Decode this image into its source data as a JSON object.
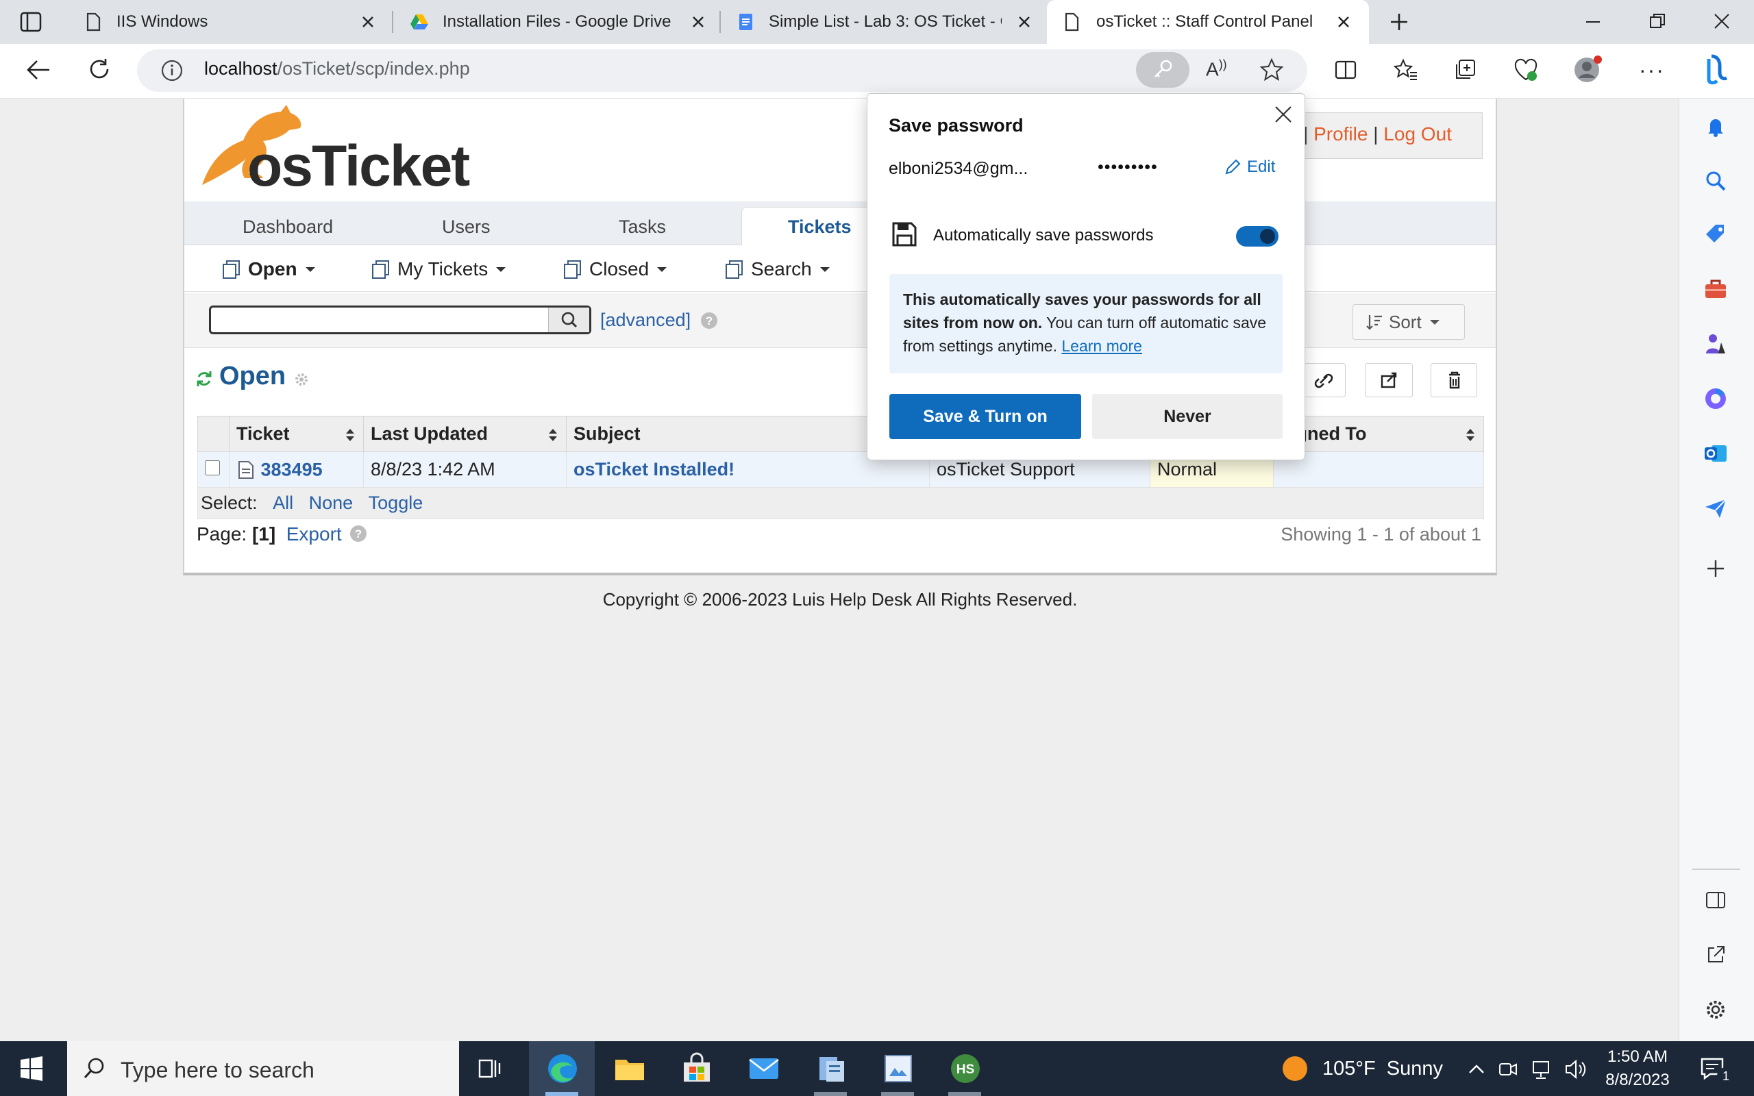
{
  "tabs": [
    {
      "title": "IIS Windows"
    },
    {
      "title": "Installation Files - Google Drive"
    },
    {
      "title": "Simple List - Lab 3: OS Ticket - G"
    },
    {
      "title": "osTicket :: Staff Control Panel"
    }
  ],
  "address": {
    "host": "localhost",
    "path": "/osTicket/scp/index.php"
  },
  "header": {
    "profile_link": "Profile",
    "logout_link": "Log Out",
    "separator": "|",
    "partial_link": "l"
  },
  "logo": {
    "text": "osTicket"
  },
  "nav": {
    "tabs": [
      "Dashboard",
      "Users",
      "Tasks",
      "Tickets"
    ],
    "active": "Tickets"
  },
  "subnav": {
    "open": "Open",
    "my_tickets": "My Tickets",
    "closed": "Closed",
    "search": "Search"
  },
  "search": {
    "value": "",
    "advanced_link": "[advanced]",
    "sort_label": "Sort"
  },
  "queue": {
    "title": "Open"
  },
  "table": {
    "headers": [
      "Ticket",
      "Last Updated",
      "Subject",
      "",
      "",
      "signed To"
    ],
    "rows": [
      {
        "ticket": "383495",
        "updated": "8/8/23 1:42 AM",
        "subject": "osTicket Installed!",
        "from": "osTicket Support",
        "priority": "Normal",
        "assigned": ""
      }
    ]
  },
  "select_bar": {
    "label": "Select:",
    "all": "All",
    "none": "None",
    "toggle": "Toggle"
  },
  "pager": {
    "label": "Page:",
    "current": "[1]",
    "export": "Export",
    "showing": "Showing 1 - 1 of about 1"
  },
  "footer": {
    "copyright": "Copyright © 2006-2023 Luis Help Desk All Rights Reserved."
  },
  "popup": {
    "title": "Save password",
    "username": "elboni2534@gm...",
    "password": "•••••••••",
    "edit": "Edit",
    "auto_save_label": "Automatically save passwords",
    "auto_save_on": true,
    "info_bold": "This automatically saves your passwords for all sites from now on.",
    "info_rest": " You can turn off automatic save from settings anytime.",
    "learn_more": "Learn more",
    "save_button": "Save & Turn on",
    "never_button": "Never"
  },
  "taskbar": {
    "search_placeholder": "Type here to search",
    "weather": "105°F  Sunny",
    "time": "1:50 AM",
    "date": "8/8/2023",
    "notification_count": "1"
  },
  "colors": {
    "accent": "#0f6cbd",
    "link": "#2a60a5",
    "logo_orange": "#f0962e",
    "header_link": "#e35d2a"
  }
}
